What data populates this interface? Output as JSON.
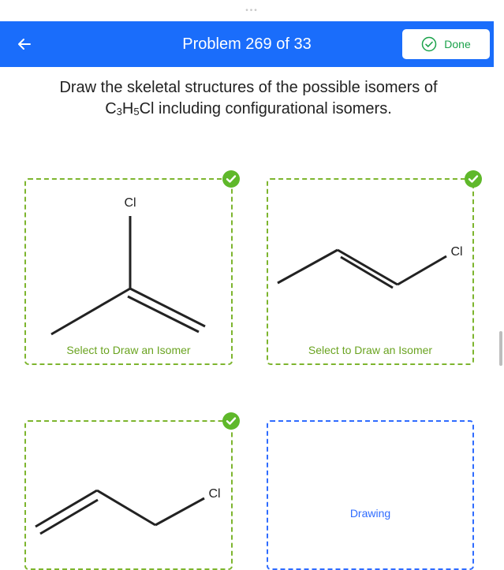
{
  "header": {
    "title": "Problem 269 of 33",
    "done_label": "Done"
  },
  "prompt": {
    "line1": "Draw the skeletal structures of the possible isomers of",
    "formula_c": "C",
    "formula_c_sub": "3",
    "formula_h": "H",
    "formula_h_sub": "5",
    "formula_cl": "Cl",
    "line2_rest": " including configurational isomers."
  },
  "cards": [
    {
      "label": "Select to Draw an Isomer",
      "atom": "Cl",
      "checked": true
    },
    {
      "label": "Select to Draw an Isomer",
      "atom": "Cl",
      "checked": true
    },
    {
      "label": "",
      "atom": "Cl",
      "checked": true
    },
    {
      "label": "Drawing",
      "atom": "",
      "checked": false
    }
  ],
  "colors": {
    "header": "#1a6dfb",
    "done_text": "#1aa24a",
    "card_border": "#7db52e",
    "active_border": "#2f6cff",
    "check_badge": "#5fb82a"
  }
}
